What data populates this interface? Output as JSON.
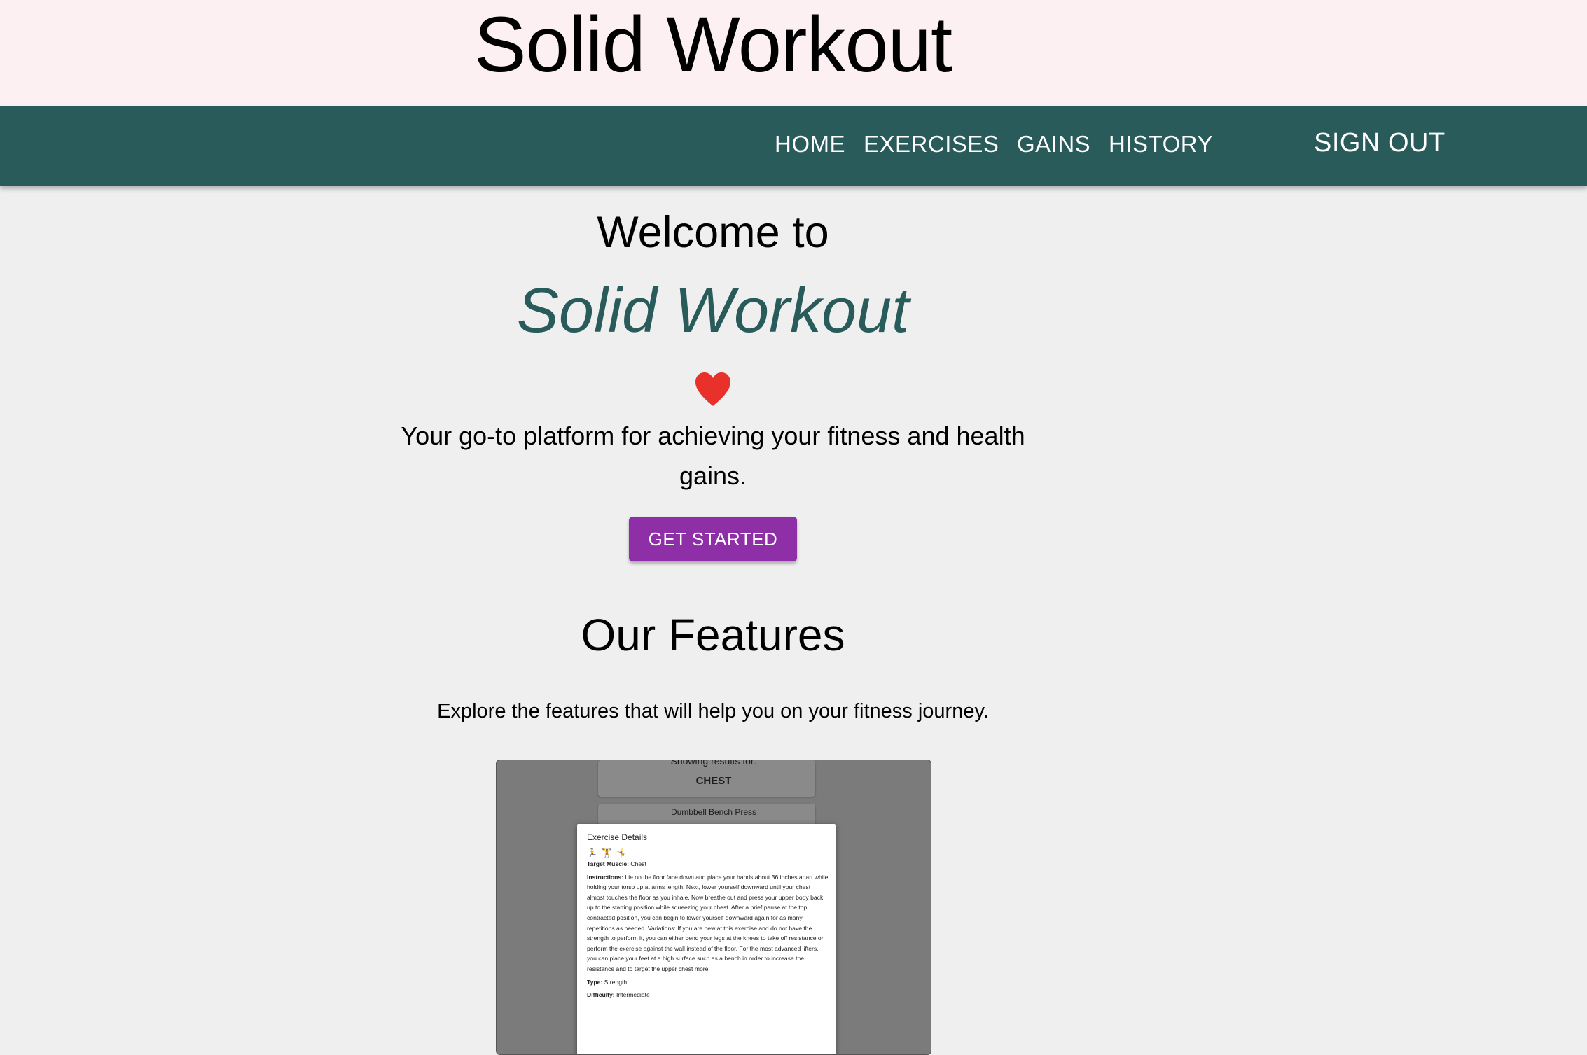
{
  "header": {
    "site_title": "Solid Workout"
  },
  "nav": {
    "items": [
      {
        "label": "HOME"
      },
      {
        "label": "EXERCISES"
      },
      {
        "label": "GAINS"
      },
      {
        "label": "HISTORY"
      }
    ],
    "sign_out_label": "SIGN OUT"
  },
  "hero": {
    "welcome": "Welcome to",
    "brand": "Solid Workout",
    "heart_icon": "heart-icon",
    "tagline": "Your go-to platform for achieving your fitness and health gains.",
    "cta_label": "GET STARTED"
  },
  "features": {
    "heading": "Our Features",
    "subtitle": "Explore the features that will help you on your fitness journey.",
    "preview": {
      "showing_text": "Showing results for:",
      "muscle": "CHEST",
      "first_exercise": "Dumbbell Bench Press",
      "modal": {
        "title": "Exercise Details",
        "icons": "🏃 🏋 🤸",
        "target_label": "Target Muscle:",
        "target_value": "Chest",
        "instructions_label": "Instructions:",
        "instructions_value": "Lie on the floor face down and place your hands about 36 inches apart while holding your torso up at arms length. Next, lower yourself downward until your chest almost touches the floor as you inhale. Now breathe out and press your upper body back up to the starting position while squeezing your chest. After a brief pause at the top contracted position, you can begin to lower yourself downward again for as many repetitions as needed. Variations: If you are new at this exercise and do not have the strength to perform it, you can either bend your legs at the knees to take off resistance or perform the exercise against the wall instead of the floor. For the most advanced lifters, you can place your feet at a high surface such as a bench in order to increase the resistance and to target the upper chest more.",
        "type_label": "Type:",
        "type_value": "Strength",
        "difficulty_label": "Difficulty:",
        "difficulty_value": "Intermediate"
      }
    }
  },
  "colors": {
    "header_bg": "#fcf0f3",
    "nav_bg": "#285b5a",
    "brand_text": "#285b5a",
    "cta_bg": "#8e2fa8",
    "heart": "#e8312a",
    "page_bg": "#efefef"
  }
}
